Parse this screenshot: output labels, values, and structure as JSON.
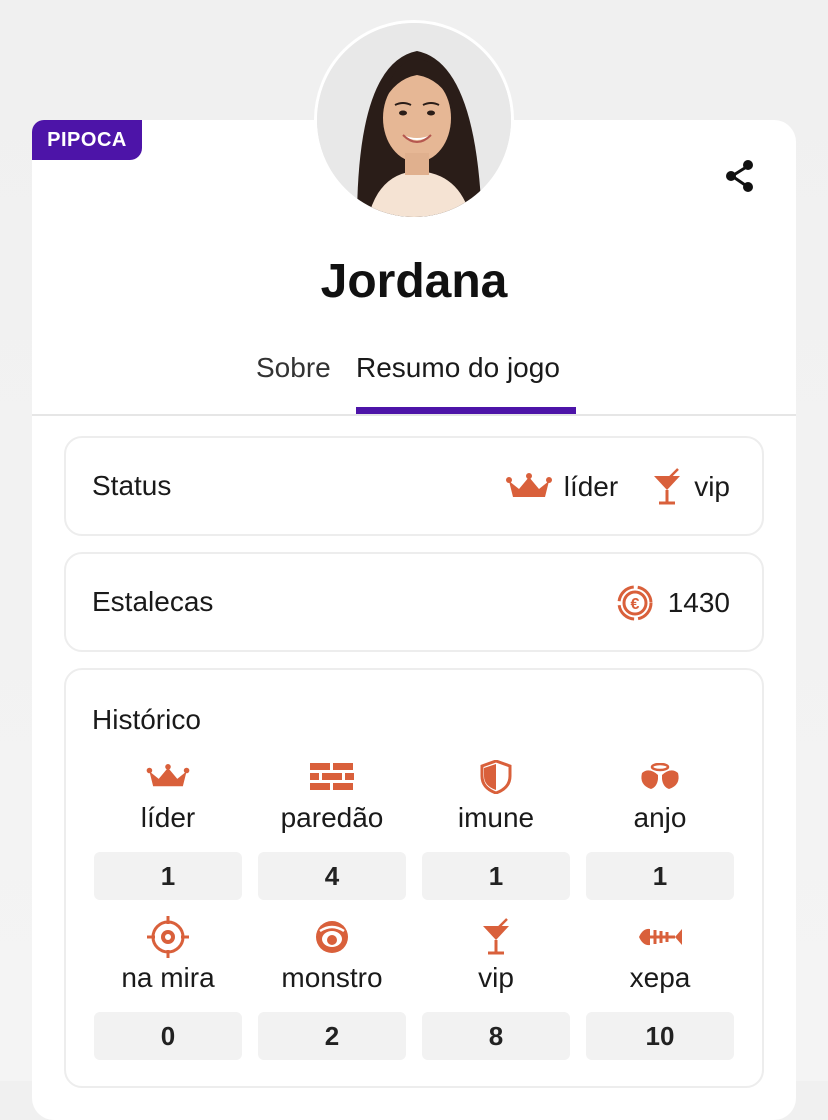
{
  "participant": {
    "tag": "PIPOCA",
    "name": "Jordana"
  },
  "tabs": [
    {
      "label": "Sobre"
    },
    {
      "label": "Resumo do jogo"
    }
  ],
  "status": {
    "label": "Status",
    "items": [
      {
        "icon": "crown-icon",
        "text": "líder"
      },
      {
        "icon": "cocktail-icon",
        "text": "vip"
      }
    ]
  },
  "estalecas": {
    "label": "Estalecas",
    "icon": "coin-icon",
    "value": "1430"
  },
  "historico": {
    "label": "Histórico",
    "items": [
      {
        "icon": "crown-icon",
        "label": "líder",
        "value": "1"
      },
      {
        "icon": "brick-wall-icon",
        "label": "paredão",
        "value": "4"
      },
      {
        "icon": "shield-icon",
        "label": "imune",
        "value": "1"
      },
      {
        "icon": "angel-wings-icon",
        "label": "anjo",
        "value": "1"
      },
      {
        "icon": "target-icon",
        "label": "na mira",
        "value": "0"
      },
      {
        "icon": "monster-icon",
        "label": "monstro",
        "value": "2"
      },
      {
        "icon": "cocktail-icon",
        "label": "vip",
        "value": "8"
      },
      {
        "icon": "fishbone-icon",
        "label": "xepa",
        "value": "10"
      }
    ]
  },
  "colors": {
    "accent": "#4d14a8",
    "icon": "#d9603b"
  }
}
